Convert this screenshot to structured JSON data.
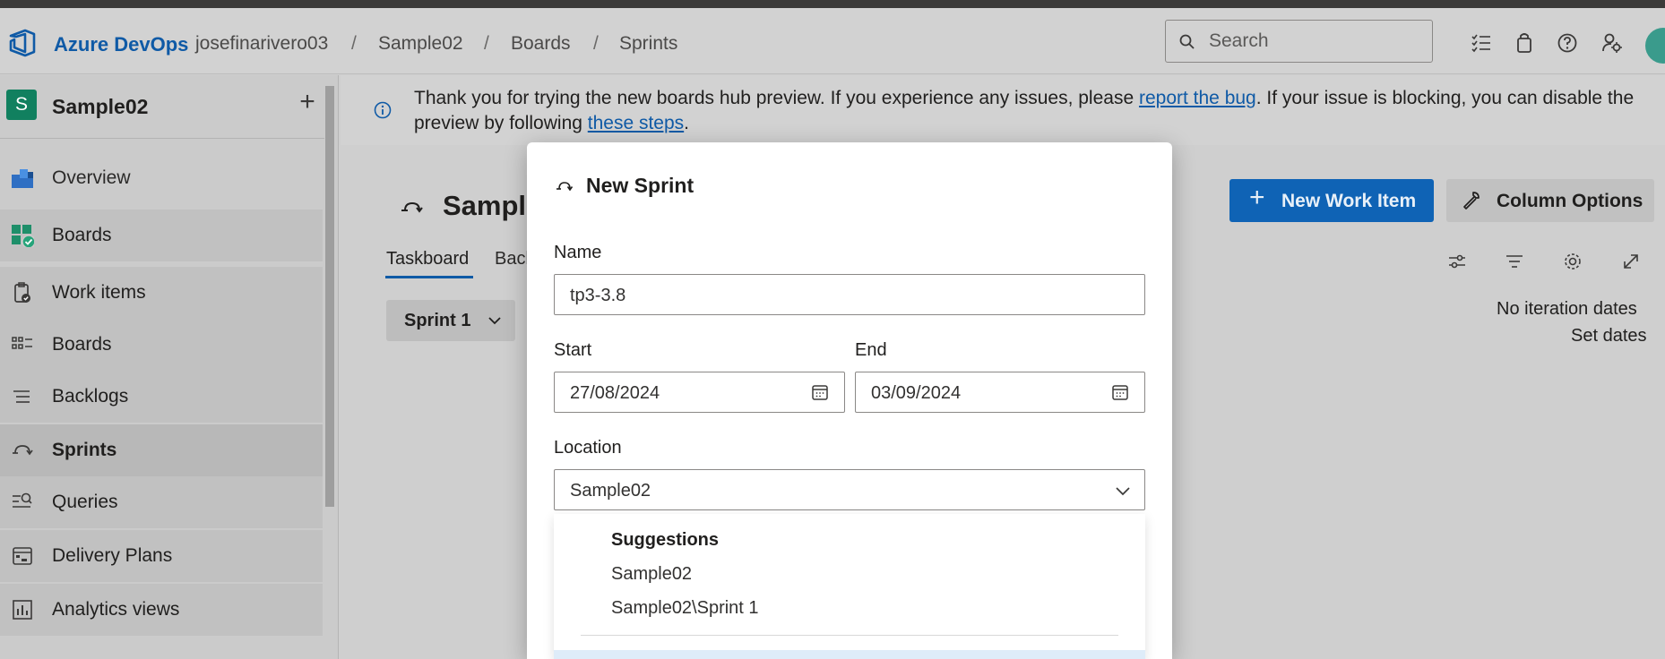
{
  "header": {
    "brand": "Azure DevOps",
    "breadcrumbs": [
      "josefinarivero03",
      "Sample02",
      "Boards",
      "Sprints"
    ],
    "search_placeholder": "Search",
    "icons": [
      "task-list-icon",
      "shopping-bag-icon",
      "help-icon",
      "user-settings-icon"
    ]
  },
  "sidebar": {
    "project_initial": "S",
    "project_name": "Sample02",
    "items": [
      {
        "label": "Overview",
        "icon": "overview-icon"
      },
      {
        "label": "Boards",
        "icon": "boards-hub-icon"
      },
      {
        "label": "Work items",
        "icon": "work-items-icon"
      },
      {
        "label": "Boards",
        "icon": "boards-icon"
      },
      {
        "label": "Backlogs",
        "icon": "backlogs-icon"
      },
      {
        "label": "Sprints",
        "icon": "sprints-icon"
      },
      {
        "label": "Queries",
        "icon": "queries-icon"
      },
      {
        "label": "Delivery Plans",
        "icon": "delivery-plans-icon"
      },
      {
        "label": "Analytics views",
        "icon": "analytics-icon"
      }
    ]
  },
  "banner": {
    "text_before": "Thank you for trying the new boards hub preview. If you experience any issues, please ",
    "link1": "report the bug",
    "text_middle": ". If your issue is blocking, you can disable the preview by following ",
    "link2": "these steps",
    "text_after": "."
  },
  "main": {
    "title": "Sample",
    "tabs": [
      "Taskboard",
      "Back"
    ],
    "sprint_picker": "Sprint 1",
    "new_work_item": "New Work Item",
    "column_options": "Column Options",
    "no_iteration_dates": "No iteration dates",
    "set_dates": "Set dates"
  },
  "dialog": {
    "title": "New Sprint",
    "name_label": "Name",
    "name_value": "tp3-3.8",
    "start_label": "Start",
    "start_value": "27/08/2024",
    "end_label": "End",
    "end_value": "03/09/2024",
    "location_label": "Location",
    "location_value": "Sample02",
    "dropdown": {
      "heading": "Suggestions",
      "options": [
        "Sample02",
        "Sample02\\Sprint 1"
      ]
    }
  },
  "colors": {
    "brand_blue": "#0f5aa6",
    "primary_button": "#0f63b5",
    "project_badge": "#11805f"
  }
}
